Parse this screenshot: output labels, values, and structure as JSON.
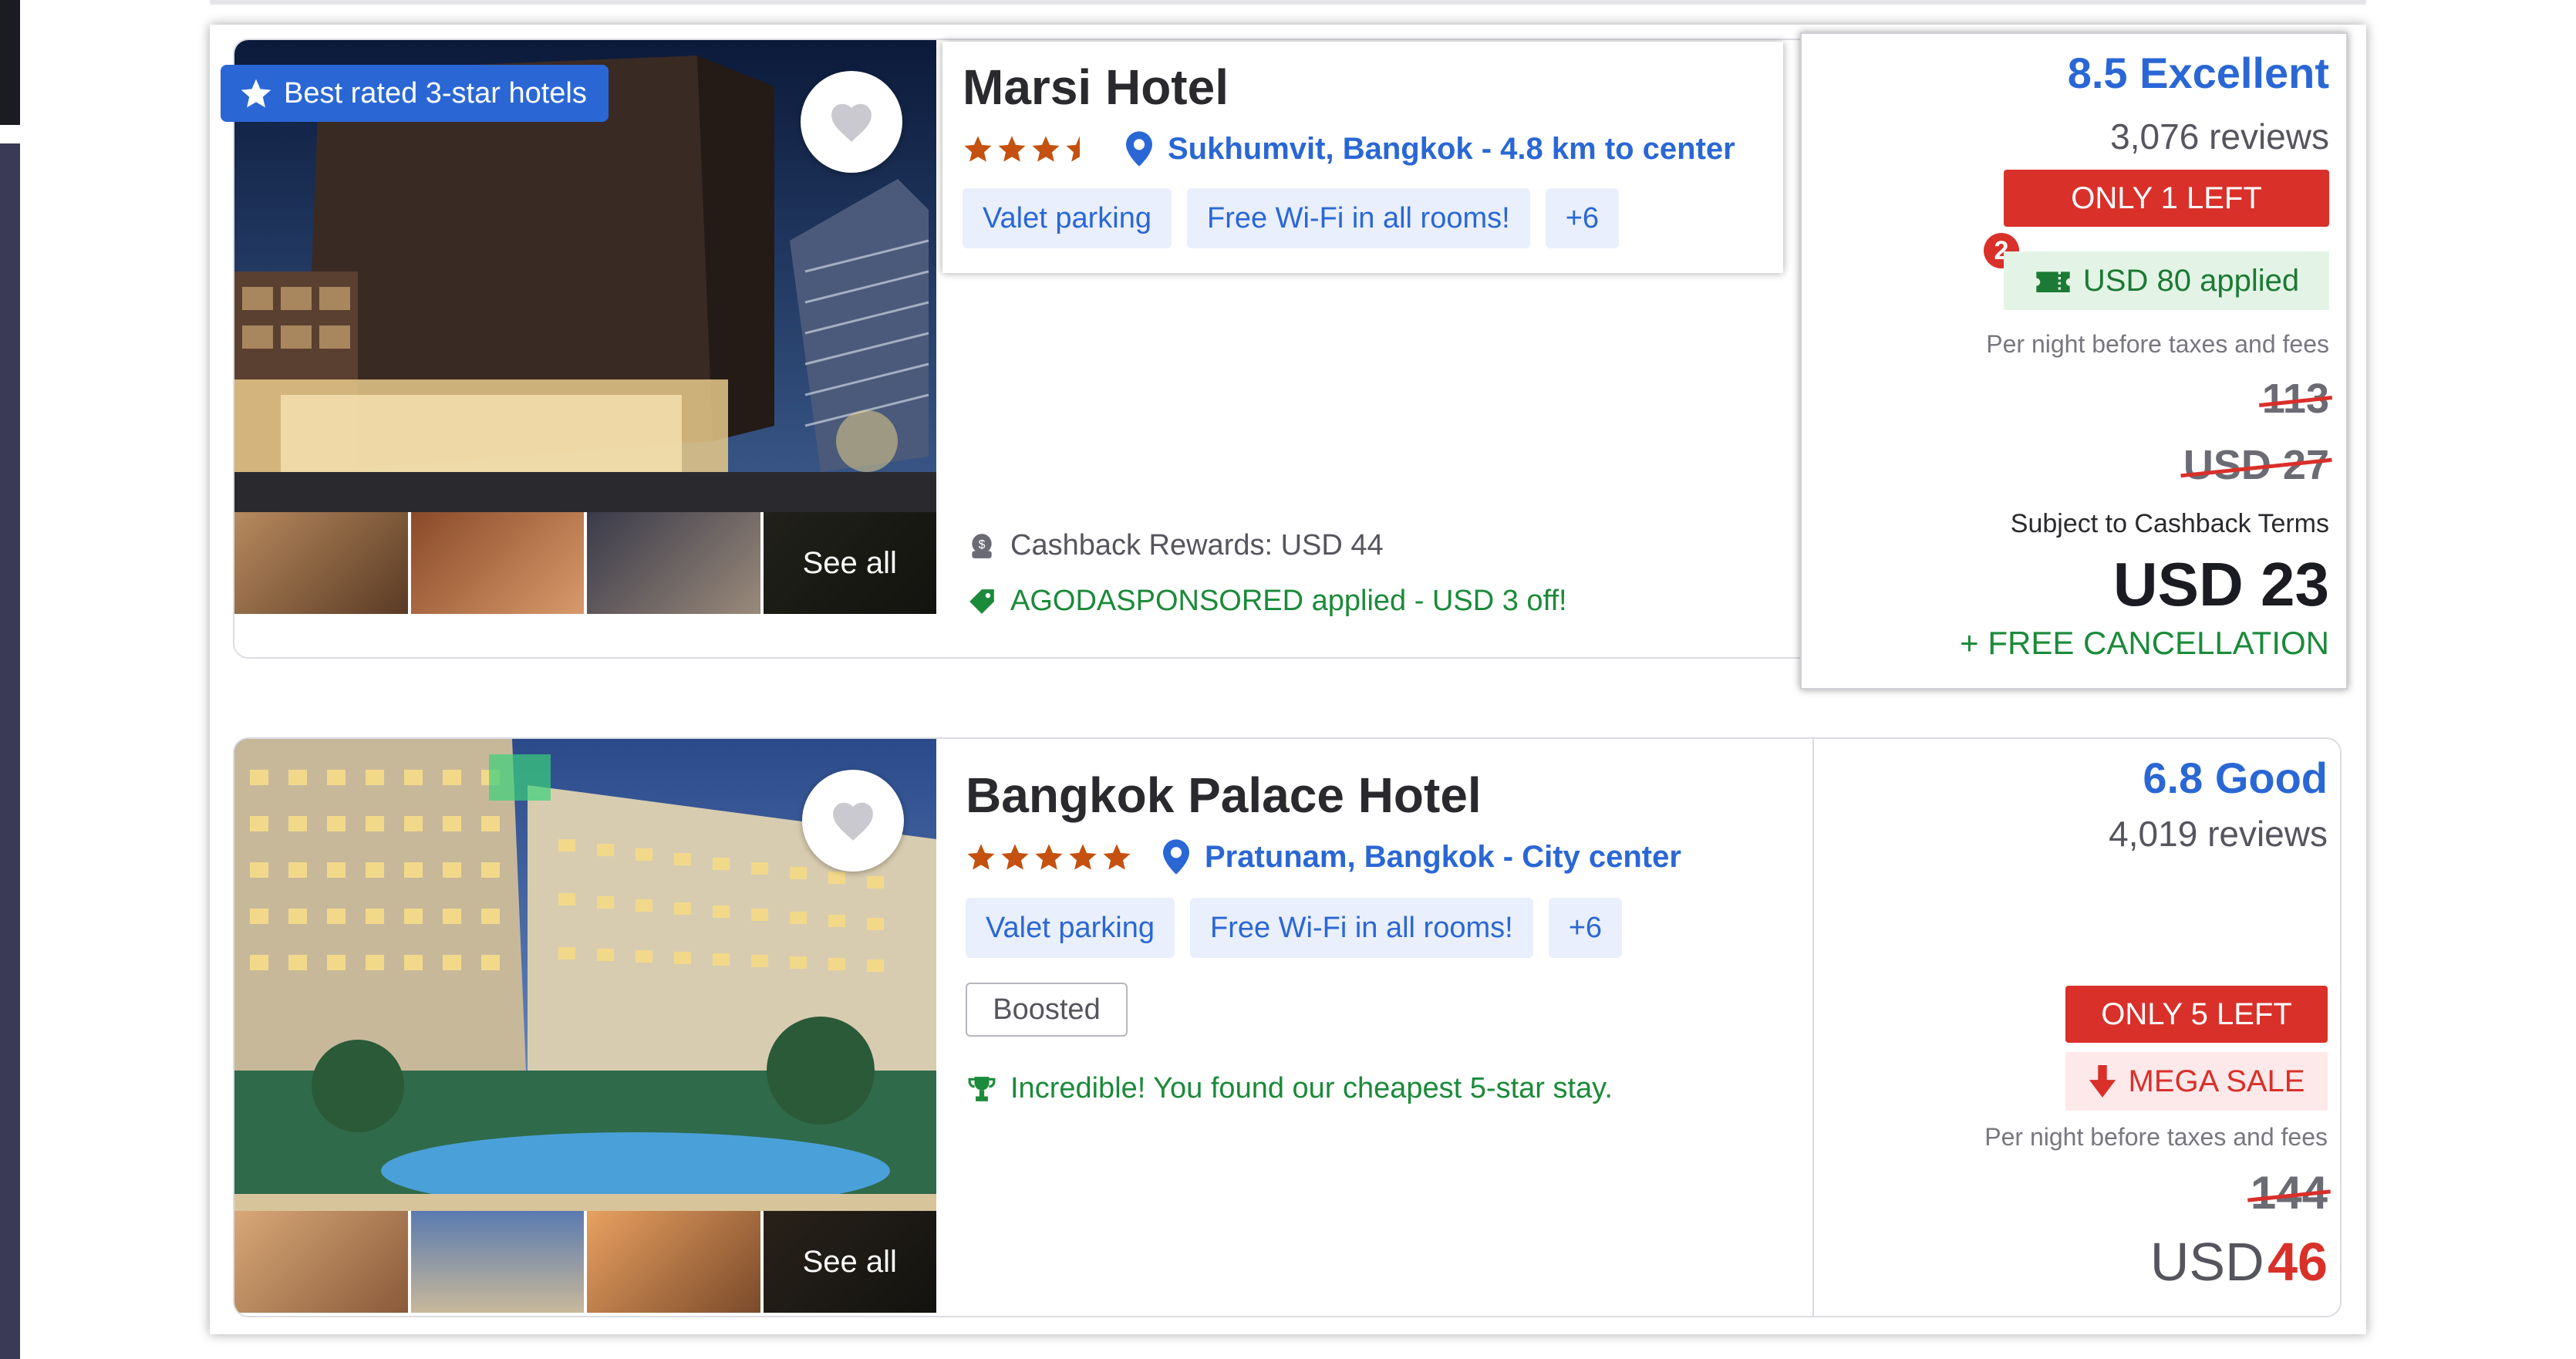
{
  "hotels": [
    {
      "badge": "Best rated 3-star hotels",
      "name": "Marsi Hotel",
      "stars": 3.5,
      "location": "Sukhumvit, Bangkok - 4.8 km to center",
      "amenities": [
        "Valet parking",
        "Free Wi-Fi in all rooms!",
        "+6"
      ],
      "see_all": "See all",
      "perks": [
        "Cashback Rewards: USD 44",
        "AGODASPONSORED applied - USD 3 off!"
      ],
      "rating": "8.5 Excellent",
      "reviews": "3,076 reviews",
      "availability": "ONLY 1 LEFT",
      "coupon_count": "2",
      "coupon": "USD 80 applied",
      "per_night": "Per night before taxes and fees",
      "original_price": "113",
      "crossed_price": "USD 27",
      "subject_note": "Subject to Cashback Terms",
      "final_price": "USD 23",
      "cancellation": "+ FREE CANCELLATION"
    },
    {
      "name": "Bangkok Palace Hotel",
      "stars": 5,
      "location": "Pratunam, Bangkok - City center",
      "amenities": [
        "Valet parking",
        "Free Wi-Fi in all rooms!",
        "+6"
      ],
      "boosted": "Boosted",
      "see_all": "See all",
      "perks": [
        "Incredible! You found our cheapest 5-star stay."
      ],
      "rating": "6.8 Good",
      "reviews": "4,019 reviews",
      "availability": "ONLY 5 LEFT",
      "sale": "MEGA SALE",
      "per_night": "Per night before taxes and fees",
      "original_price": "144",
      "final_currency": "USD",
      "final_amount": "46"
    }
  ],
  "colors": {
    "accent_blue": "#2a67d5",
    "alert_red": "#d9302a",
    "success_green": "#1b8a3a",
    "star_orange": "#c4510f"
  }
}
